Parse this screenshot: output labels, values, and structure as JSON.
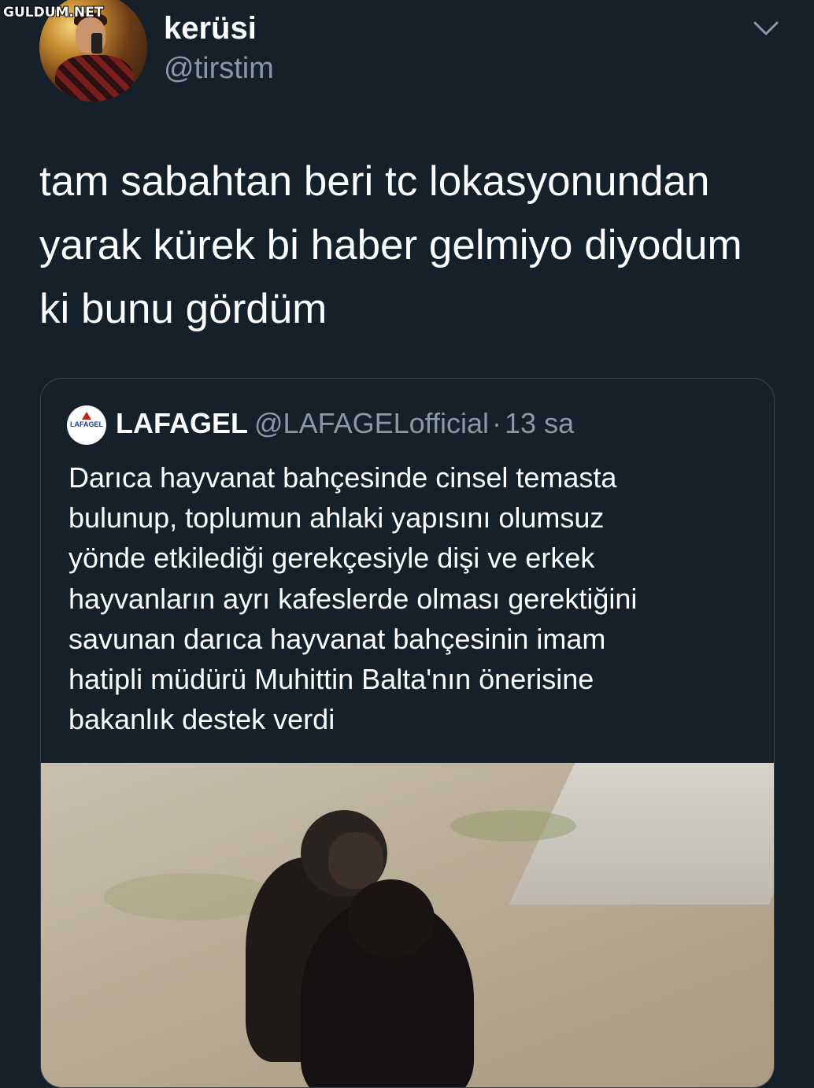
{
  "watermark": "GULDUM.NET",
  "tweet": {
    "display_name": "kerüsi",
    "handle": "@tirstim",
    "text": "tam sabahtan beri tc lokasyonundan\nyarak kürek bi haber gelmiyo diyodum\nki  bunu gördüm",
    "menu_icon": "chevron-down-icon"
  },
  "quoted": {
    "display_name": "LAFAGEL",
    "handle": "@LAFAGELofficial",
    "separator": "·",
    "time": "13 sa",
    "logo_text": "LAFAGEL",
    "text": "Darıca hayvanat bahçesinde cinsel temasta\nbulunup, toplumun ahlaki yapısını olumsuz\nyönde etkilediği gerekçesiyle dişi ve erkek\nhayvanların ayrı kafeslerde olması gerektiğini\nsavunan darıca hayvanat bahçesinin imam\nhatipli müdürü Muhittin Balta'nın önerisine\nbakanlık destek verdi",
    "media": "photo of two bonobos"
  },
  "colors": {
    "background": "#15202b",
    "secondary_text": "#8899a6",
    "border": "#38444d"
  }
}
